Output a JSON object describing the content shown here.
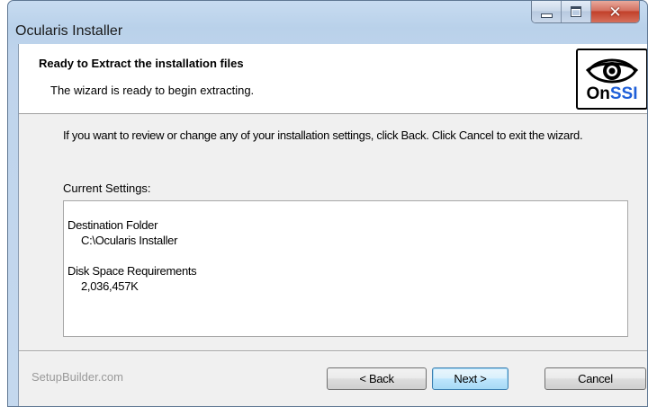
{
  "window": {
    "title": "Ocularis Installer"
  },
  "header": {
    "title": "Ready to Extract the installation files",
    "subtitle": "The wizard is ready to begin extracting.",
    "logo": {
      "text_prefix": "On",
      "text_suffix": "SSI",
      "icon": "eye-icon"
    }
  },
  "body": {
    "description": "If you want to review or change any of your installation settings, click Back. Click Cancel to exit the wizard.",
    "current_settings_label": "Current Settings:",
    "settings": {
      "destination_label": "Destination Folder",
      "destination_value": "C:\\Ocularis Installer",
      "disk_label": "Disk Space Requirements",
      "disk_value": "2,036,457K"
    }
  },
  "footer": {
    "brand": "SetupBuilder.com",
    "back_label": "< Back",
    "next_label": "Next >",
    "cancel_label": "Cancel"
  },
  "colors": {
    "logo_ssi": "#1f5fd8",
    "close_button": "#c2402a",
    "default_button_border": "#3c7fb1"
  }
}
